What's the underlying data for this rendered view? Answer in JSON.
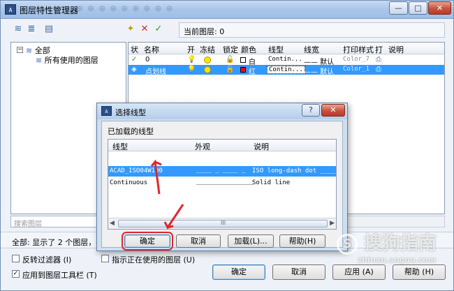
{
  "window": {
    "title": "图层特性管理器",
    "title_ghost": "⊕⊕⊕⊕⊕⊕⊕⊕⊕",
    "min_label": "—",
    "max_label": "□",
    "close_label": "✕"
  },
  "current_layer": "当前图层: 0",
  "tree": {
    "root_label": "全部",
    "child_label": "所有使用的图层",
    "expander": "−"
  },
  "layer_table": {
    "headers": [
      "状",
      "名称",
      "开",
      "冻结",
      "锁定",
      "颜色",
      "线型",
      "线宽",
      "打印样式",
      "打",
      "说明"
    ],
    "rows": [
      {
        "status": "✓",
        "name": "0",
        "color_name": "白",
        "color_hex": "#ffffff",
        "linetype": "Contin...",
        "lineweight": "—— 默认",
        "plot_style": "Color_7"
      },
      {
        "status": "◈",
        "name": "点划线",
        "color_name": "红",
        "color_hex": "#ff0000",
        "linetype": "Contin...",
        "lineweight": "—— 默认",
        "plot_style": "Color_1"
      }
    ]
  },
  "search": {
    "placeholder": "搜索图层"
  },
  "status_text": "全部: 显示了 2 个图层，共",
  "checkboxes": {
    "invert_filter": "反转过滤器 (I)",
    "apply_toolbar": "应用到图层工具栏 (T)",
    "in_use": "指示正在使用的图层 (U)"
  },
  "main_buttons": {
    "ok": "确定",
    "cancel": "取消",
    "apply": "应用 (A)",
    "help": "帮助 (H)"
  },
  "dialog": {
    "title": "选择线型",
    "help_btn": "?",
    "close_btn": "✕",
    "section": "已加载的线型",
    "headers": [
      "线型",
      "外观",
      "说明"
    ],
    "rows": [
      {
        "name": "ACAD_ISO04W100",
        "appearance": "____ _ ____ _",
        "description": "ISO long-dash dot ____ _"
      },
      {
        "name": "Continuous",
        "appearance": "_______________",
        "description": "Solid line"
      }
    ],
    "scroll_thumb": "III",
    "buttons": {
      "ok": "确定",
      "cancel": "取消",
      "load": "加载(L)...",
      "help": "帮助(H)"
    }
  },
  "watermark": {
    "brand": "搜狗指南",
    "url": "zhinan.sogou.com"
  }
}
